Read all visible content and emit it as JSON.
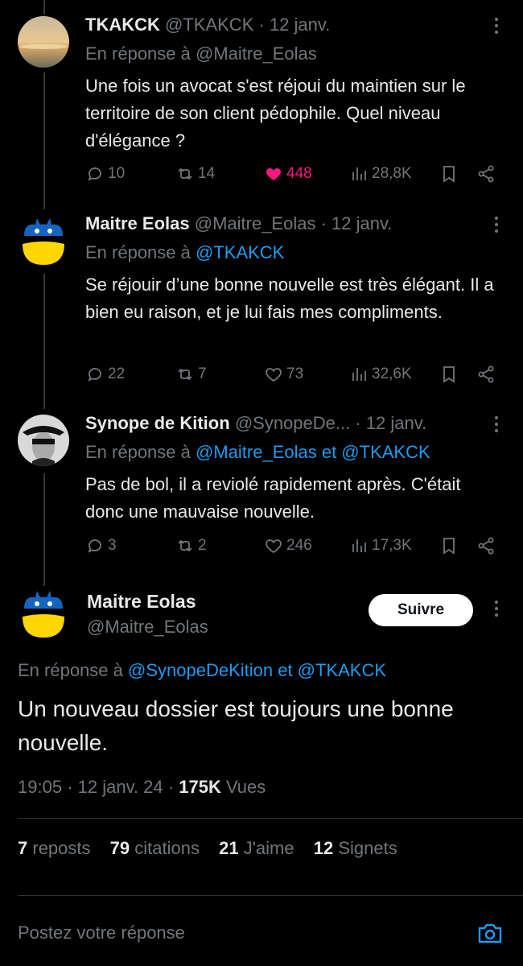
{
  "tweets": [
    {
      "name": "TKAKCK",
      "handle": "@TKAKCK",
      "date": "· 12 janv.",
      "reply_prefix": "En réponse à",
      "reply_targets": "@Maitre_Eolas",
      "reply_link_style": "grey",
      "text": "Une fois un avocat s'est réjoui du maintien sur le territoire de son client pédophile. Quel niveau d'élégance ?",
      "replies": "10",
      "reposts": "14",
      "likes": "448",
      "liked": true,
      "views": "28,8K"
    },
    {
      "name": "Maitre Eolas",
      "handle": "@Maitre_Eolas",
      "date": "· 12 janv.",
      "reply_prefix": "En réponse à",
      "reply_targets": "@TKAKCK",
      "text": "Se réjouir d’une bonne nouvelle est très élégant. Il a bien eu raison, et je lui fais mes compliments.",
      "replies": "22",
      "reposts": "7",
      "likes": "73",
      "liked": false,
      "views": "32,6K"
    },
    {
      "name": "Synope de Kition",
      "handle": "@SynopeDe...",
      "date": "· 12 janv.",
      "reply_prefix": "En réponse à",
      "reply_targets": "@Maitre_Eolas et @TKAKCK",
      "text": "Pas de bol, il a reviolé rapidement après. C'était donc une mauvaise nouvelle.",
      "replies": "3",
      "reposts": "2",
      "likes": "246",
      "liked": false,
      "views": "17,3K"
    }
  ],
  "main": {
    "name": "Maitre Eolas",
    "handle": "@Maitre_Eolas",
    "follow_label": "Suivre",
    "reply_prefix": "En réponse à",
    "reply_targets": "@SynopeDeKition et @TKAKCK",
    "text": "Un nouveau dossier est toujours une bonne nouvelle.",
    "time": "19:05",
    "date": "12 janv. 24",
    "views_count": "175K",
    "views_label": "Vues",
    "reposts_count": "7",
    "reposts_label": "reposts",
    "quotes_count": "79",
    "quotes_label": "citations",
    "likes_count": "21",
    "likes_label": "J'aime",
    "bookmarks_count": "12",
    "bookmarks_label": "Signets"
  },
  "compose": {
    "placeholder": "Postez votre réponse"
  },
  "colors": {
    "accent": "#1d9bf0",
    "like": "#f91880",
    "muted": "#71767b",
    "background": "#000000"
  }
}
